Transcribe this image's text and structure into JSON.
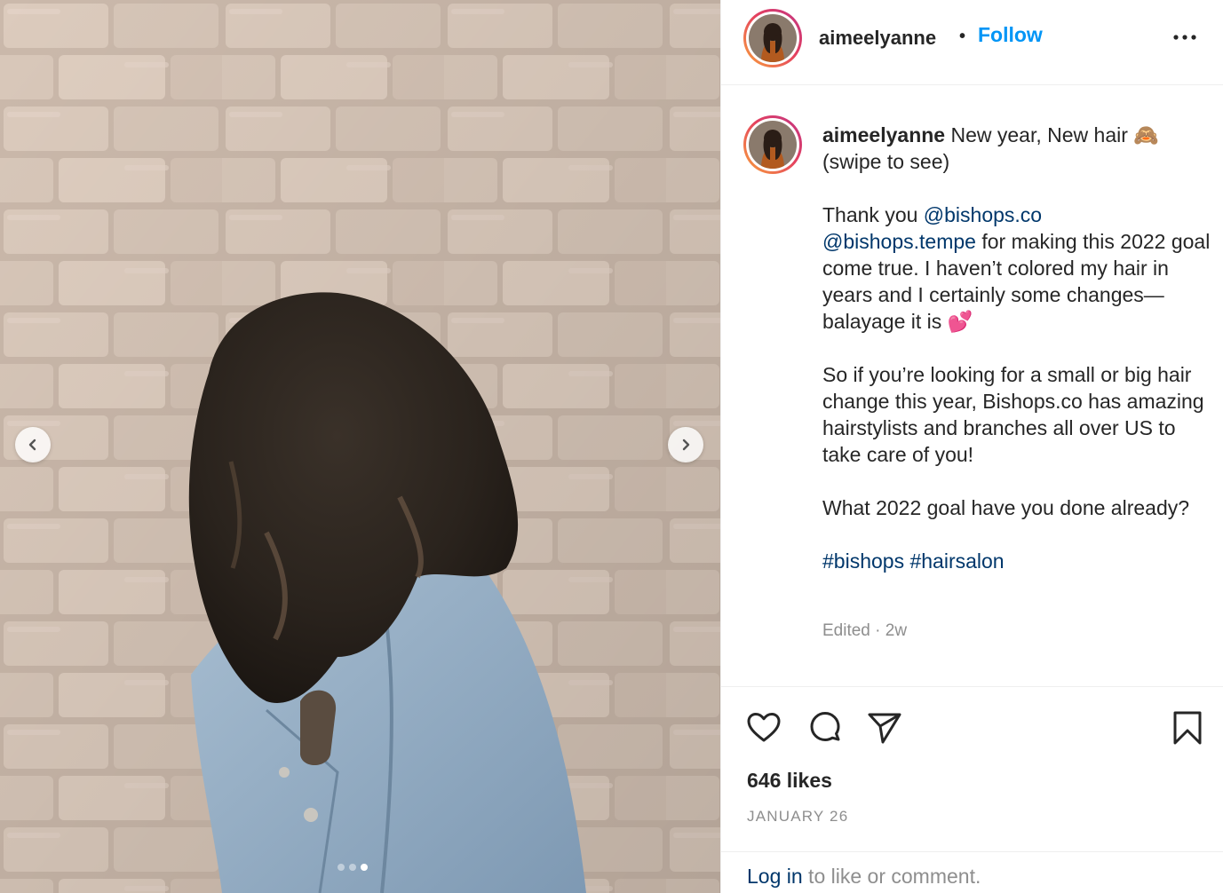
{
  "post": {
    "username": "aimeelyanne",
    "follow_label": "Follow",
    "separator": "•"
  },
  "caption": {
    "username": "aimeelyanne",
    "line1": "New year, New hair 🙈",
    "line2": "(swipe to see)",
    "p2_pre": "Thank you ",
    "mention1": "@bishops.co",
    "mention2": "@bishops.tempe",
    "p2_post": " for making this 2022 goal come true. I haven’t colored my hair in years and I certainly some changes— balayage it is 💕",
    "p3": "So if you’re looking for a small or big hair change this year, Bishops.co has amazing hairstylists and branches all over US to take care of you!",
    "p4": "What 2022 goal have you done already?",
    "hashtag1": "#bishops",
    "hashtag2": "#hairsalon",
    "edited": "Edited · 2w"
  },
  "stats": {
    "likes": "646 likes",
    "date": "JANUARY 26"
  },
  "login": {
    "link": "Log in",
    "rest": " to like or comment."
  },
  "carousel": {
    "total": 3,
    "active_index": 2
  },
  "icons": [
    "more-options-icon",
    "heart-icon",
    "comment-icon",
    "share-icon",
    "bookmark-icon",
    "chevron-left-icon",
    "chevron-right-icon"
  ],
  "colors": {
    "follow": "#0095f6",
    "link": "#00376b",
    "muted": "#8e8e8e",
    "text": "#262626"
  }
}
